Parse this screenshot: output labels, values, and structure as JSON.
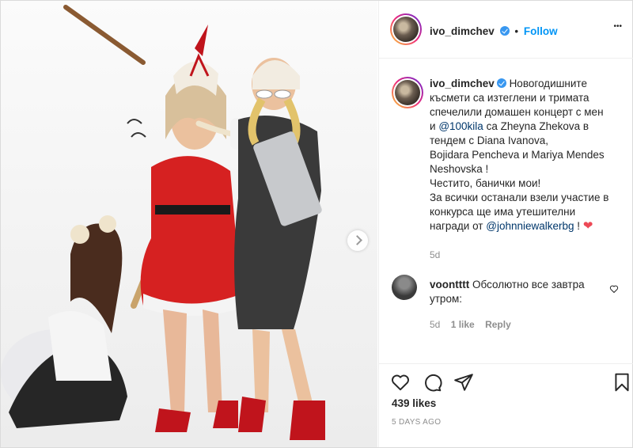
{
  "header": {
    "username": "ivo_dimchev",
    "separator": "•",
    "follow_label": "Follow",
    "more_label": "•••"
  },
  "caption": {
    "username": "ivo_dimchev",
    "lines": [
      "Новогодишните",
      "късмети са изтеглени и тримата",
      "спечелили домашен концерт с мен",
      "са Zheyna Zhekova в",
      "тендем с Diana Ivanova,",
      "Bojidara Pencheva и Mariya Mendes",
      "Neshovska !",
      "Честито, банички мои!",
      "За всички останали взели участие в",
      "конкурса ще има утешителни",
      "награди от"
    ],
    "prefix_and": "и",
    "mention_1": "@100kila",
    "mention_2": "@johnniewalkerbg",
    "suffix": "!",
    "heart": "❤",
    "age": "5d"
  },
  "comment": {
    "username": "voontttt",
    "text_line1": "Обсолютно все завтра",
    "text_line2": "утром:",
    "age": "5d",
    "likes_label": "1 like",
    "reply_label": "Reply"
  },
  "actions": {
    "likes": "439 likes",
    "time_ago": "5 DAYS AGO"
  },
  "colors": {
    "accent": "#0095f6",
    "verified": "#3897f0",
    "link": "#00376b",
    "muted": "#8e8e8e"
  },
  "icons": [
    "verified-badge-icon",
    "more-options-icon",
    "like-icon",
    "comment-icon",
    "share-icon",
    "save-icon",
    "comment-like-icon",
    "next-arrow-icon"
  ]
}
